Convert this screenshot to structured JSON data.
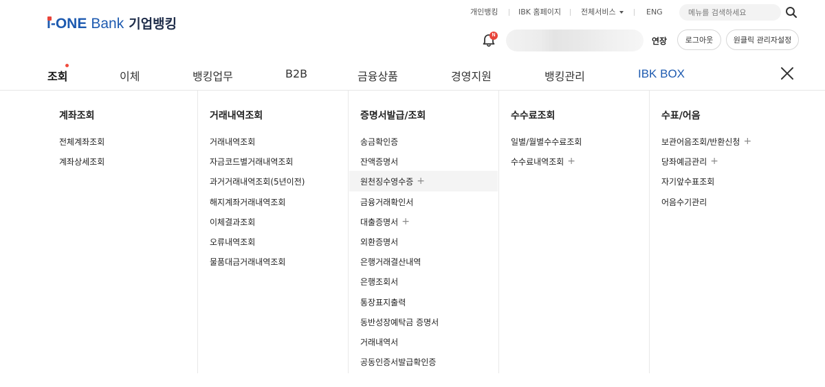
{
  "logo": {
    "i": "i",
    "one": "-ONE",
    "bank": "Bank",
    "kor": "기업뱅킹"
  },
  "utility": {
    "personal": "개인뱅킹",
    "homepage": "IBK 홈페이지",
    "all_services": "전체서비스",
    "eng": "ENG",
    "search_placeholder": "메뉴를 검색하세요"
  },
  "account_bar": {
    "bell_badge": "N",
    "extend": "연장",
    "logout": "로그아웃",
    "admin_setting": "원클릭 관리자설정"
  },
  "gnb": [
    {
      "label": "조회",
      "active": true
    },
    {
      "label": "이체"
    },
    {
      "label": "뱅킹업무"
    },
    {
      "label": "B2B"
    },
    {
      "label": "금융상품"
    },
    {
      "label": "경영지원"
    },
    {
      "label": "뱅킹관리"
    },
    {
      "label": "IBK BOX"
    }
  ],
  "mega": {
    "col1": {
      "title": "계좌조회",
      "items": [
        "전체계좌조회",
        "계좌상세조회"
      ]
    },
    "col2": {
      "title": "거래내역조회",
      "items": [
        "거래내역조회",
        "자금코드별거래내역조회",
        "과거거래내역조회(5년이전)",
        "해지계좌거래내역조회",
        "이체결과조회",
        "오류내역조회",
        "물품대금거래내역조회"
      ]
    },
    "col3": {
      "title": "증명서발급/조회",
      "items": [
        "송금확인증",
        "잔액증명서",
        "원천징수영수증",
        "금융거래확인서",
        "대출증명서",
        "외환증명서",
        "은행거래결산내역",
        "은행조회서",
        "통장표지출력",
        "동반성장예탁금 증명서",
        "거래내역서",
        "공동인증서발급확인증"
      ]
    },
    "col4": {
      "title": "수수료조회",
      "items": [
        "일별/월별수수료조회",
        "수수료내역조회"
      ]
    },
    "col5": {
      "title": "수표/어음",
      "items": [
        "보관어음조회/반환신청",
        "당좌예금관리",
        "자기앞수표조회",
        "어음수기관리"
      ]
    },
    "expand_symbol": "+"
  },
  "colors": {
    "brand_blue": "#1d5ab0",
    "accent_red": "#e8443a"
  }
}
